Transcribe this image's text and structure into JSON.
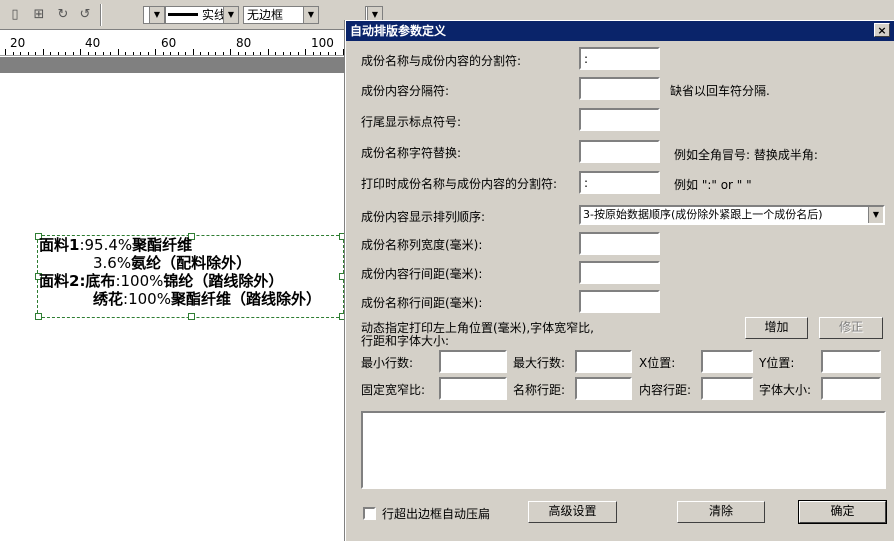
{
  "toolbar": {
    "line_style": "实线",
    "border_style": "无边框"
  },
  "ruler": {
    "labels": [
      "20",
      "40",
      "60",
      "80",
      "100"
    ]
  },
  "canvas": {
    "line1_prefix": "面料1",
    "line1_value": ":95.4%",
    "line1_fiber": "聚酯纤维",
    "line2_value": "3.6%",
    "line2_fiber": "氨纶（配料除外）",
    "line3_prefix": "面料2",
    "line3_part": ":底布",
    "line3_value": ":100%",
    "line3_fiber": "锦纶（踏线除外）",
    "line4_part": "绣花",
    "line4_value": ":100%",
    "line4_fiber": "聚酯纤维（踏线除外）"
  },
  "dialog": {
    "title": "自动排版参数定义",
    "close": "×",
    "fields": {
      "name_content_sep_label": "成份名称与成份内容的分割符:",
      "name_content_sep_value": ":",
      "content_sep_label": "成份内容分隔符:",
      "content_sep_value": "",
      "content_sep_hint": "缺省以回车符分隔.",
      "line_end_label": "行尾显示标点符号:",
      "line_end_value": "",
      "name_replace_label": "成份名称字符替换:",
      "name_replace_value": "",
      "name_replace_hint": "例如全角冒号: 替换成半角:",
      "print_sep_label": "打印时成份名称与成份内容的分割符:",
      "print_sep_value": ":",
      "print_sep_hint": "例如 \":\" or \" \"",
      "order_label": "成份内容显示排列顺序:",
      "order_value": "3-按原始数据顺序(成份除外紧跟上一个成份名后)",
      "name_col_width_label": "成份名称列宽度(毫米):",
      "content_line_spacing_label": "成份内容行间距(毫米):",
      "name_line_spacing_label": "成份名称行间距(毫米):"
    },
    "dynamic": {
      "heading_line1": "动态指定打印左上角位置(毫米),字体宽窄比,",
      "heading_line2": "行距和字体大小:",
      "add_button": "增加",
      "modify_button": "修正",
      "min_rows": "最小行数:",
      "max_rows": "最大行数:",
      "x_pos": "X位置:",
      "y_pos": "Y位置:",
      "fixed_ratio": "固定宽窄比:",
      "name_spacing": "名称行距:",
      "content_spacing": "内容行距:",
      "font_size": "字体大小:"
    },
    "footer": {
      "auto_compress": "行超出边框自动压扁",
      "advanced_button": "高级设置",
      "clear_button": "清除",
      "ok_button": "确定"
    }
  }
}
